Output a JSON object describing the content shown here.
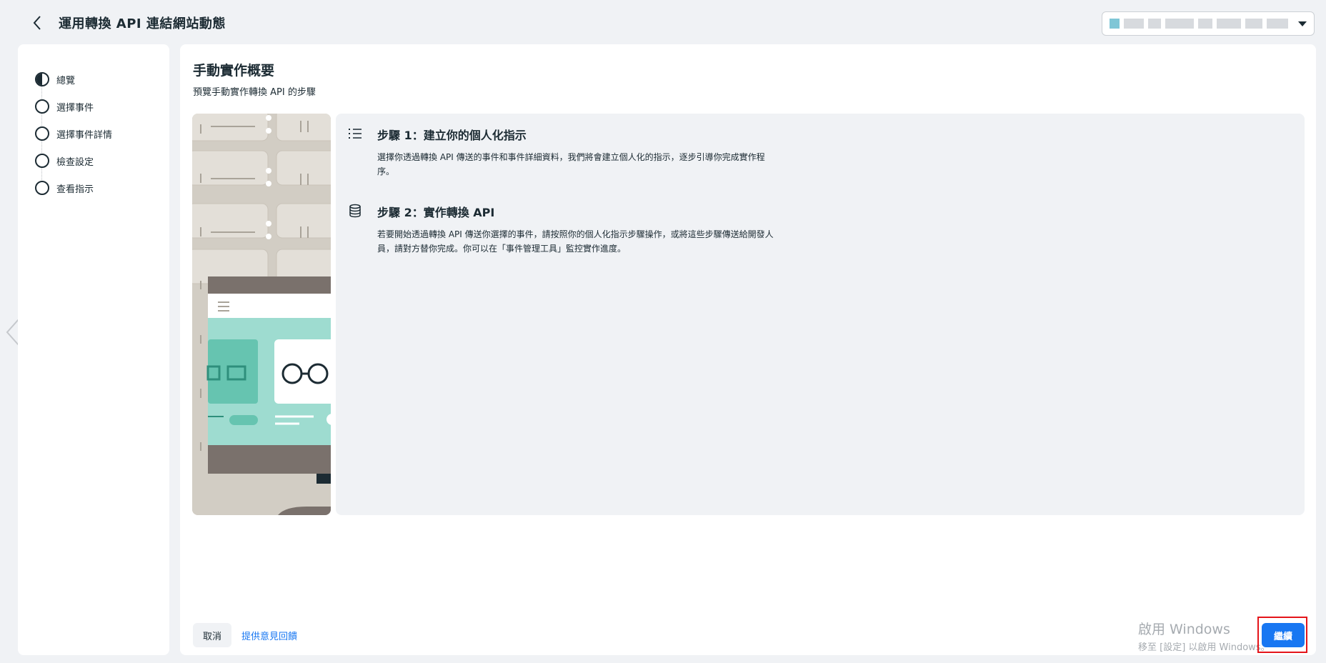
{
  "header": {
    "title": "運用轉換 API 連結網站動態",
    "back_icon": "chevron-left-icon",
    "account_selector": {
      "value": ""
    }
  },
  "sidebar": {
    "items": [
      {
        "label": "總覽",
        "state": "in-progress"
      },
      {
        "label": "選擇事件",
        "state": "pending"
      },
      {
        "label": "選擇事件詳情",
        "state": "pending"
      },
      {
        "label": "檢查設定",
        "state": "pending"
      },
      {
        "label": "查看指示",
        "state": "pending"
      }
    ]
  },
  "main": {
    "title": "手動實作概要",
    "subtitle": "預覽手動實作轉換 API 的步驟",
    "steps": [
      {
        "icon": "list-icon",
        "title": "步驟 1：建立你的個人化指示",
        "description": "選擇你透過轉換 API 傳送的事件和事件詳細資料，我們將會建立個人化的指示，逐步引導你完成實作程序。"
      },
      {
        "icon": "database-icon",
        "title": "步驟 2：實作轉換 API",
        "description": "若要開始透過轉換 API 傳送你選擇的事件，請按照你的個人化指示步驟操作，或將這些步驟傳送給開發人員，請對方替你完成。你可以在「事件管理工具」監控實作進度。"
      }
    ]
  },
  "footer": {
    "cancel_label": "取消",
    "feedback_label": "提供意見回饋",
    "continue_label": "繼續"
  },
  "watermark": {
    "line1": "啟用 Windows",
    "line2": "移至 [設定] 以啟用 Windows。"
  },
  "colors": {
    "primary": "#1877f2",
    "background": "#f0f2f5",
    "highlight": "#e4141a"
  }
}
